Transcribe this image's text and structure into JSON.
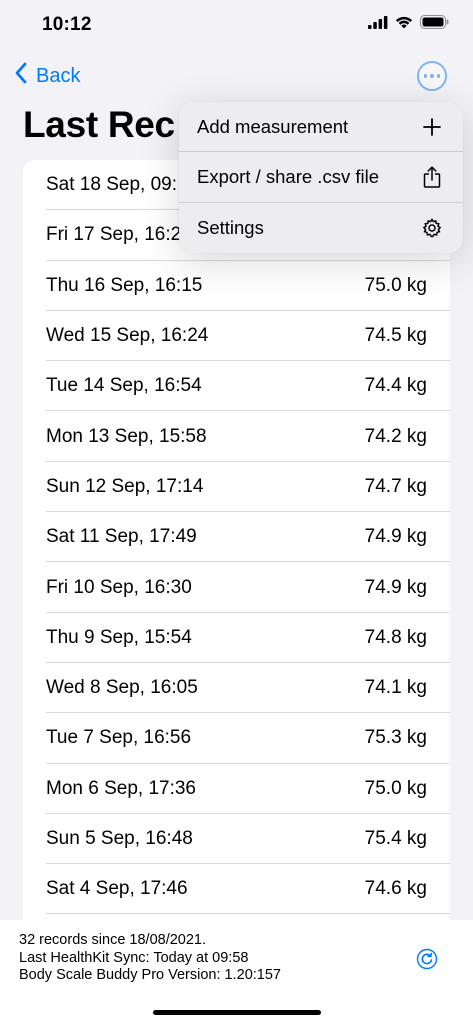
{
  "status_bar": {
    "time": "10:12"
  },
  "nav": {
    "back_label": "Back",
    "title": "Last Rec"
  },
  "menu": {
    "items": [
      {
        "label": "Add measurement",
        "icon": "plus-icon"
      },
      {
        "label": "Export / share .csv file",
        "icon": "share-icon"
      },
      {
        "label": "Settings",
        "icon": "gear-icon"
      }
    ]
  },
  "records": [
    {
      "date": "Sat 18 Sep, 09:",
      "weight": ""
    },
    {
      "date": "Fri 17 Sep, 16:2",
      "weight": ""
    },
    {
      "date": "Thu 16 Sep, 16:15",
      "weight": "75.0 kg"
    },
    {
      "date": "Wed 15 Sep, 16:24",
      "weight": "74.5 kg"
    },
    {
      "date": "Tue 14 Sep, 16:54",
      "weight": "74.4 kg"
    },
    {
      "date": "Mon 13 Sep, 15:58",
      "weight": "74.2 kg"
    },
    {
      "date": "Sun 12 Sep, 17:14",
      "weight": "74.7 kg"
    },
    {
      "date": "Sat 11 Sep, 17:49",
      "weight": "74.9 kg"
    },
    {
      "date": "Fri 10 Sep, 16:30",
      "weight": "74.9 kg"
    },
    {
      "date": "Thu 9 Sep, 15:54",
      "weight": "74.8 kg"
    },
    {
      "date": "Wed 8 Sep, 16:05",
      "weight": "74.1 kg"
    },
    {
      "date": "Tue 7 Sep, 16:56",
      "weight": "75.3 kg"
    },
    {
      "date": "Mon 6 Sep, 17:36",
      "weight": "75.0 kg"
    },
    {
      "date": "Sun 5 Sep, 16:48",
      "weight": "75.4 kg"
    },
    {
      "date": "Sat 4 Sep, 17:46",
      "weight": "74.6 kg"
    }
  ],
  "footer": {
    "records_line": "32 records since 18/08/2021.",
    "sync_line": "Last HealthKit Sync: Today at 09:58",
    "version_line": "Body Scale Buddy Pro Version: 1.20:157"
  },
  "colors": {
    "accent": "#007AFF",
    "background": "#F2F2F7"
  }
}
